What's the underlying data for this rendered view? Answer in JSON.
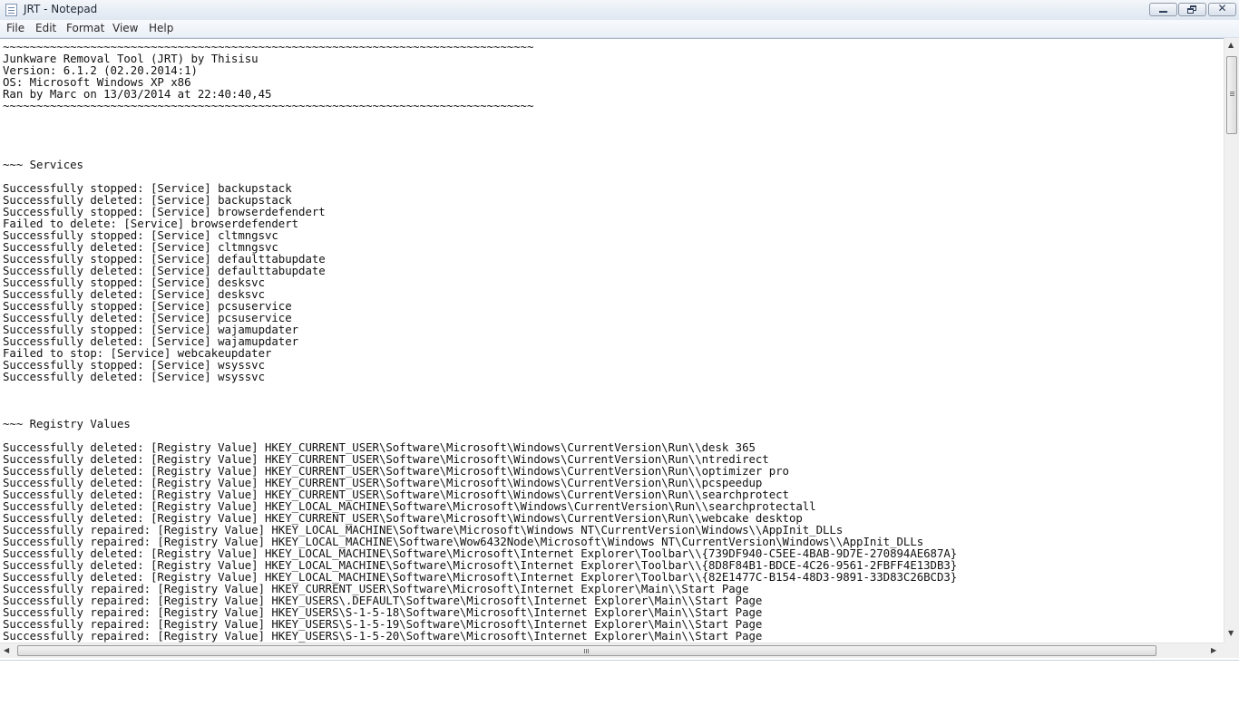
{
  "window": {
    "title": "JRT - Notepad"
  },
  "menu": {
    "file": "File",
    "edit": "Edit",
    "format": "Format",
    "view": "View",
    "help": "Help"
  },
  "icons": {
    "app": "notepad-icon",
    "minimize": "minimize-icon",
    "maximize": "restore-icon",
    "close": "close-icon",
    "close_glyph": "✕",
    "scroll_up": "▲",
    "scroll_down": "▼",
    "scroll_left": "◀",
    "scroll_right": "▶"
  },
  "document": {
    "text": "~~~~~~~~~~~~~~~~~~~~~~~~~~~~~~~~~~~~~~~~~~~~~~~~~~~~~~~~~~~~~~~~~~~~~~~~~~~~~~~\nJunkware Removal Tool (JRT) by Thisisu\nVersion: 6.1.2 (02.20.2014:1)\nOS: Microsoft Windows XP x86\nRan by Marc on 13/03/2014 at 22:40:40,45\n~~~~~~~~~~~~~~~~~~~~~~~~~~~~~~~~~~~~~~~~~~~~~~~~~~~~~~~~~~~~~~~~~~~~~~~~~~~~~~~\n\n\n\n\n~~~ Services\n\nSuccessfully stopped: [Service] backupstack\nSuccessfully deleted: [Service] backupstack\nSuccessfully stopped: [Service] browserdefendert\nFailed to delete: [Service] browserdefendert\nSuccessfully stopped: [Service] cltmngsvc\nSuccessfully deleted: [Service] cltmngsvc\nSuccessfully stopped: [Service] defaulttabupdate\nSuccessfully deleted: [Service] defaulttabupdate\nSuccessfully stopped: [Service] desksvc\nSuccessfully deleted: [Service] desksvc\nSuccessfully stopped: [Service] pcsuservice\nSuccessfully deleted: [Service] pcsuservice\nSuccessfully stopped: [Service] wajamupdater\nSuccessfully deleted: [Service] wajamupdater\nFailed to stop: [Service] webcakeupdater\nSuccessfully stopped: [Service] wsyssvc\nSuccessfully deleted: [Service] wsyssvc\n\n\n\n~~~ Registry Values\n\nSuccessfully deleted: [Registry Value] HKEY_CURRENT_USER\\Software\\Microsoft\\Windows\\CurrentVersion\\Run\\\\desk 365\nSuccessfully deleted: [Registry Value] HKEY_CURRENT_USER\\Software\\Microsoft\\Windows\\CurrentVersion\\Run\\\\ntredirect\nSuccessfully deleted: [Registry Value] HKEY_CURRENT_USER\\Software\\Microsoft\\Windows\\CurrentVersion\\Run\\\\optimizer pro\nSuccessfully deleted: [Registry Value] HKEY_CURRENT_USER\\Software\\Microsoft\\Windows\\CurrentVersion\\Run\\\\pcspeedup\nSuccessfully deleted: [Registry Value] HKEY_CURRENT_USER\\Software\\Microsoft\\Windows\\CurrentVersion\\Run\\\\searchprotect\nSuccessfully deleted: [Registry Value] HKEY_LOCAL_MACHINE\\Software\\Microsoft\\Windows\\CurrentVersion\\Run\\\\searchprotectall\nSuccessfully deleted: [Registry Value] HKEY_CURRENT_USER\\Software\\Microsoft\\Windows\\CurrentVersion\\Run\\\\webcake desktop\nSuccessfully repaired: [Registry Value] HKEY_LOCAL_MACHINE\\Software\\Microsoft\\Windows NT\\CurrentVersion\\Windows\\\\AppInit_DLLs\nSuccessfully repaired: [Registry Value] HKEY_LOCAL_MACHINE\\Software\\Wow6432Node\\Microsoft\\Windows NT\\CurrentVersion\\Windows\\\\AppInit_DLLs\nSuccessfully deleted: [Registry Value] HKEY_LOCAL_MACHINE\\Software\\Microsoft\\Internet Explorer\\Toolbar\\\\{739DF940-C5EE-4BAB-9D7E-270894AE687A}\nSuccessfully deleted: [Registry Value] HKEY_LOCAL_MACHINE\\Software\\Microsoft\\Internet Explorer\\Toolbar\\\\{8D8F84B1-BDCE-4C26-9561-2FBFF4E13DB3}\nSuccessfully deleted: [Registry Value] HKEY_LOCAL_MACHINE\\Software\\Microsoft\\Internet Explorer\\Toolbar\\\\{82E1477C-B154-48D3-9891-33D83C26BCD3}\nSuccessfully repaired: [Registry Value] HKEY_CURRENT_USER\\Software\\Microsoft\\Internet Explorer\\Main\\\\Start Page\nSuccessfully repaired: [Registry Value] HKEY_USERS\\.DEFAULT\\Software\\Microsoft\\Internet Explorer\\Main\\\\Start Page\nSuccessfully repaired: [Registry Value] HKEY_USERS\\S-1-5-18\\Software\\Microsoft\\Internet Explorer\\Main\\\\Start Page\nSuccessfully repaired: [Registry Value] HKEY_USERS\\S-1-5-19\\Software\\Microsoft\\Internet Explorer\\Main\\\\Start Page\nSuccessfully repaired: [Registry Value] HKEY_USERS\\S-1-5-20\\Software\\Microsoft\\Internet Explorer\\Main\\\\Start Page"
  }
}
